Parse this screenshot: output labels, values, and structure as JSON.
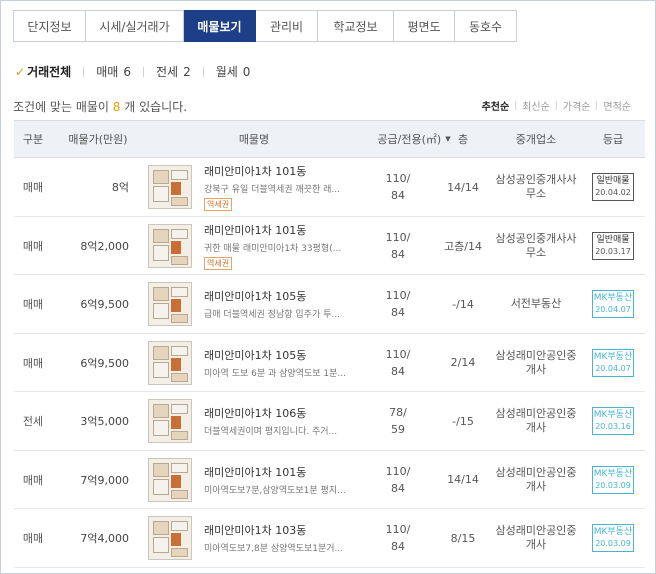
{
  "tabs": [
    {
      "label": "단지정보",
      "active": false
    },
    {
      "label": "시세/실거래가",
      "active": false
    },
    {
      "label": "매물보기",
      "active": true
    },
    {
      "label": "관리비",
      "active": false
    },
    {
      "label": "학교정보",
      "active": false
    },
    {
      "label": "평면도",
      "active": false
    },
    {
      "label": "동호수",
      "active": false
    }
  ],
  "filters": [
    {
      "label": "거래전체",
      "count": "",
      "active": true
    },
    {
      "label": "매매",
      "count": "6",
      "active": false
    },
    {
      "label": "전세",
      "count": "2",
      "active": false
    },
    {
      "label": "월세",
      "count": "0",
      "active": false
    }
  ],
  "summary": {
    "prefix": "조건에 맞는 매물이 ",
    "count": "8",
    "suffix": " 개 있습니다."
  },
  "sorts": [
    {
      "label": "추천순",
      "active": true
    },
    {
      "label": "최신순",
      "active": false
    },
    {
      "label": "가격순",
      "active": false
    },
    {
      "label": "면적순",
      "active": false
    }
  ],
  "columns": {
    "type": "구분",
    "price": "매물가(만원)",
    "name": "매물명",
    "area": "공급/전용(㎡)",
    "floor": "층",
    "agent": "중개업소",
    "grade": "등급"
  },
  "listings": [
    {
      "type": "매매",
      "price": "8억",
      "name": "래미안미아1차 101동",
      "desc": "강북구 유일 더블역세권 깨끗한 래...",
      "tag": "역세권",
      "area_supply": "110/",
      "area_exclusive": "84",
      "floor": "14/14",
      "agent": "삼성공인중개사사무소",
      "grade": "일반매물",
      "grade_date": "20.04.02",
      "grade_style": "normal"
    },
    {
      "type": "매매",
      "price": "8억2,000",
      "name": "래미안미아1차 101동",
      "desc": "귀한 매물 래미안미아1차 33평형(...",
      "tag": "역세권",
      "area_supply": "110/",
      "area_exclusive": "84",
      "floor": "고층/14",
      "agent": "삼성공인중개사사무소",
      "grade": "일반매물",
      "grade_date": "20.03.17",
      "grade_style": "normal"
    },
    {
      "type": "매매",
      "price": "6억9,500",
      "name": "래미안미아1차 105동",
      "desc": "급매 더블역세권 정남향 입주가 투...",
      "tag": "",
      "area_supply": "110/",
      "area_exclusive": "84",
      "floor": "-/14",
      "agent": "서전부동산",
      "grade": "MK부동산",
      "grade_date": "20.04.07",
      "grade_style": "mk"
    },
    {
      "type": "매매",
      "price": "6억9,500",
      "name": "래미안미아1차 105동",
      "desc": "미아역 도보 6분 과 삼양역도보 1분...",
      "tag": "",
      "area_supply": "110/",
      "area_exclusive": "84",
      "floor": "2/14",
      "agent": "삼성래미안공인중개사",
      "grade": "MK부동산",
      "grade_date": "20.04.07",
      "grade_style": "mk"
    },
    {
      "type": "전세",
      "price": "3억5,000",
      "name": "래미안미아1차 106동",
      "desc": "더블역세권이며 평지입니다. 주거...",
      "tag": "",
      "area_supply": "78/",
      "area_exclusive": "59",
      "floor": "-/15",
      "agent": "삼성래미안공인중개사",
      "grade": "MK부동산",
      "grade_date": "20.03.16",
      "grade_style": "mk"
    },
    {
      "type": "매매",
      "price": "7억9,000",
      "name": "래미안미아1차 101동",
      "desc": "미아역도보7분,삼양역도보1분 평지...",
      "tag": "",
      "area_supply": "110/",
      "area_exclusive": "84",
      "floor": "14/14",
      "agent": "삼성래미안공인중개사",
      "grade": "MK부동산",
      "grade_date": "20.03.09",
      "grade_style": "mk"
    },
    {
      "type": "매매",
      "price": "7억4,000",
      "name": "래미안미아1차 103동",
      "desc": "미아역도보7,8분 삼양역도보1분거...",
      "tag": "",
      "area_supply": "110/",
      "area_exclusive": "84",
      "floor": "8/15",
      "agent": "삼성래미안공인중개사",
      "grade": "MK부동산",
      "grade_date": "20.03.09",
      "grade_style": "mk"
    }
  ],
  "colors": {
    "active_tab": "#1d3f88",
    "highlight": "#e8a000",
    "mk_badge": "#49b6cf",
    "station_tag": "#d4712c"
  },
  "icons": {
    "filter_check": "check-icon",
    "sort_indicator": "sort-down-icon",
    "thumbnail": "floor-plan-thumbnail"
  }
}
